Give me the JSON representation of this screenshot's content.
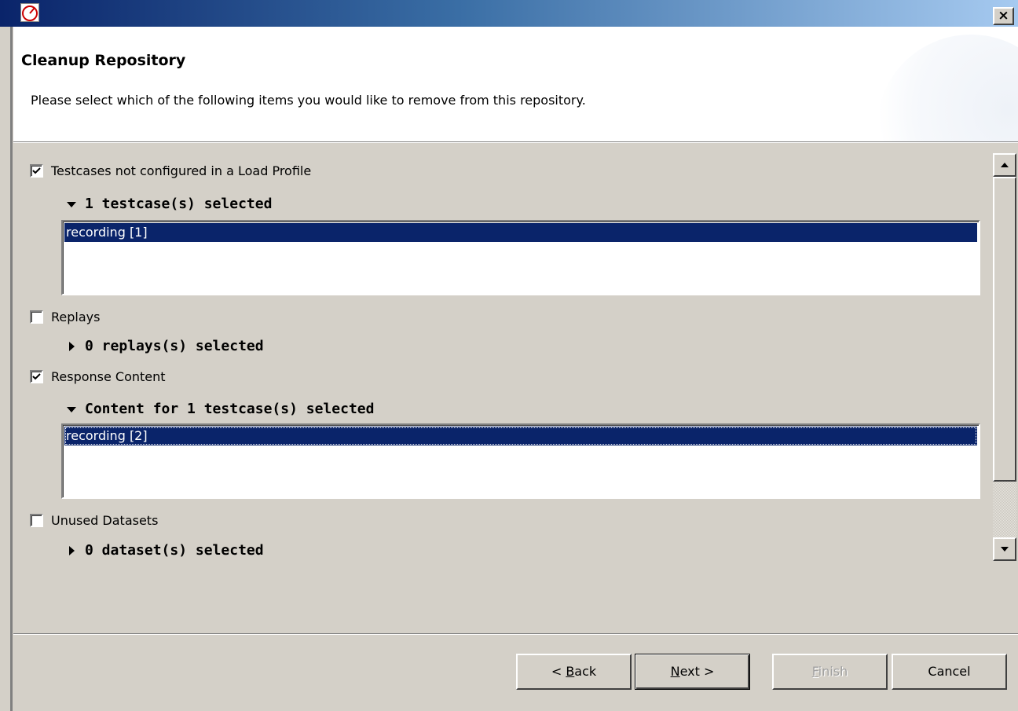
{
  "window": {
    "close_glyph": "×"
  },
  "header": {
    "title": "Cleanup Repository",
    "description": "Please select which of the following items you would like to remove from this repository."
  },
  "sections": [
    {
      "checkbox_label": "Testcases not configured in a Load Profile",
      "checked": true,
      "summary": "1 testcase(s) selected",
      "expanded": true,
      "items": [
        "recording [1]"
      ]
    },
    {
      "checkbox_label": "Replays",
      "checked": false,
      "summary": "0 replays(s) selected",
      "expanded": false,
      "items": []
    },
    {
      "checkbox_label": "Response Content",
      "checked": true,
      "summary": "Content for 1 testcase(s) selected",
      "expanded": true,
      "items": [
        "recording [2]"
      ]
    },
    {
      "checkbox_label": "Unused Datasets",
      "checked": false,
      "summary": "0 dataset(s) selected",
      "expanded": false,
      "items": []
    }
  ],
  "buttons": {
    "back": {
      "prefix": "< ",
      "mnemonic": "B",
      "rest": "ack"
    },
    "next": {
      "mnemonic": "N",
      "rest": "ext >"
    },
    "finish": {
      "mnemonic": "F",
      "rest": "inish"
    },
    "cancel": {
      "label": "Cancel"
    }
  },
  "colors": {
    "selection": "#0a246a",
    "face": "#d4d0c8"
  }
}
